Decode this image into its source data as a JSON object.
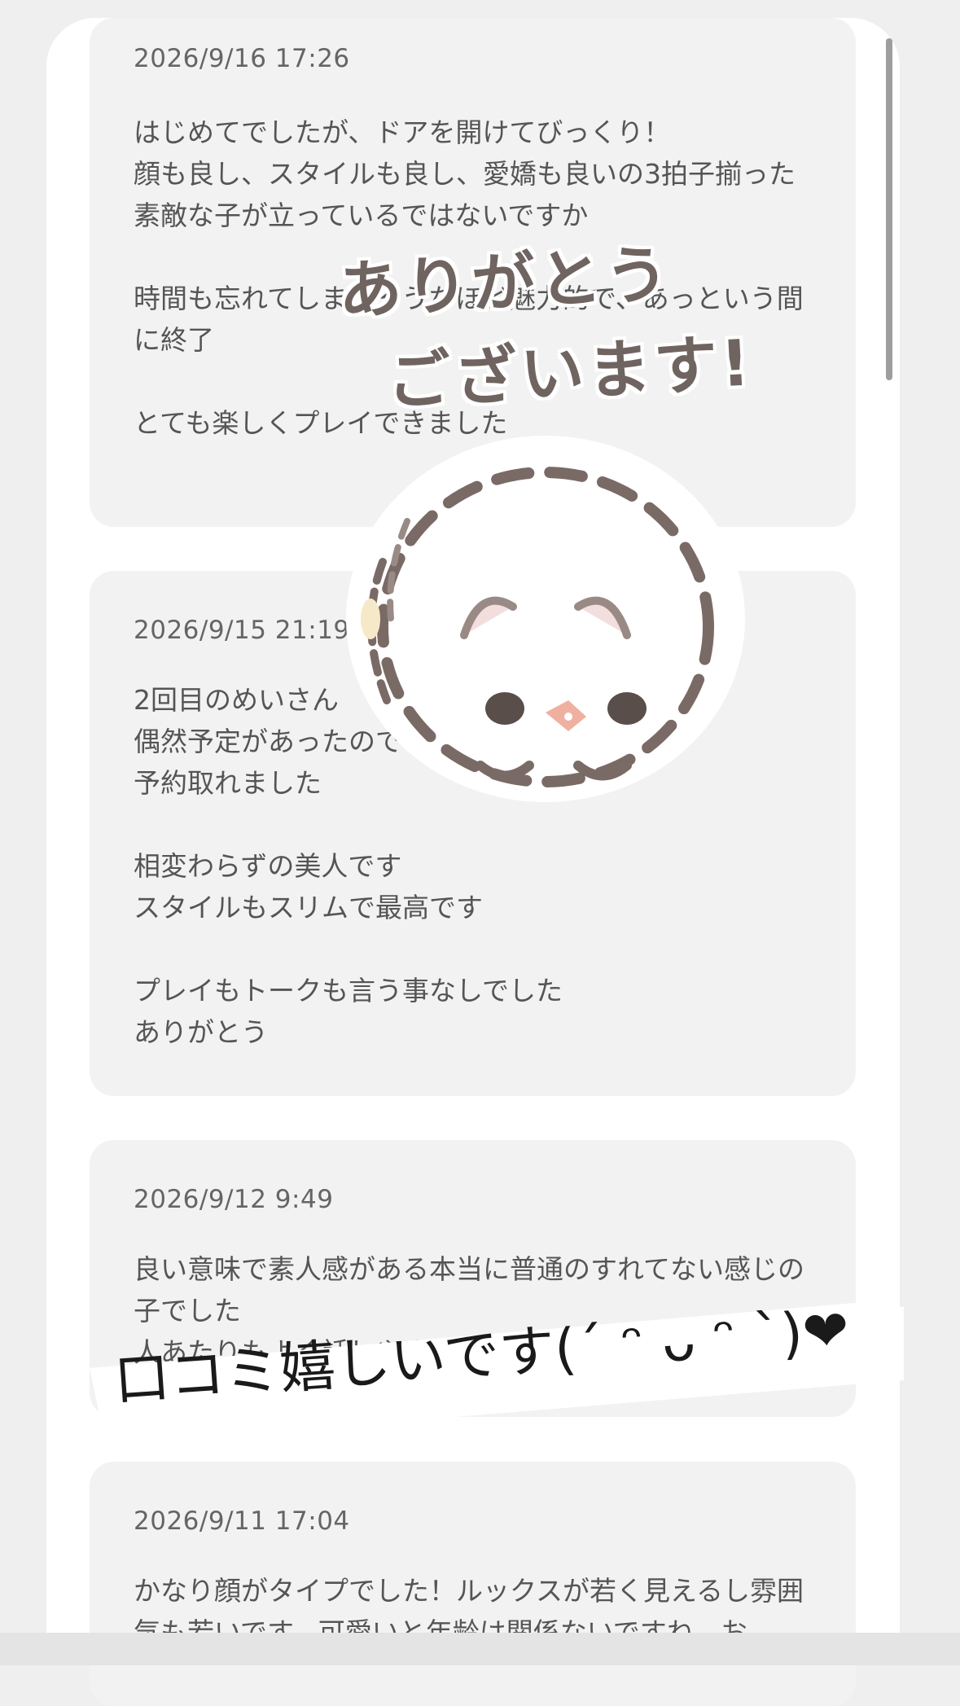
{
  "reviews": [
    {
      "date": "2026/9/16 17:26",
      "text": "はじめてでしたが、ドアを開けてびっくり！\n顔も良し、スタイルも良し、愛嬌も良いの3拍子揃った\n素敵な子が立っているではないですか\n\n時間も忘れてしまいそうなほど魅力的で、あっという間に終了\n\nとても楽しくプレイできました"
    },
    {
      "date": "2026/9/15 21:19",
      "text": "2回目のめいさん\n偶然予定があったので\n予約取れました\n\n相変わらずの美人です\nスタイルもスリムで最高です\n\nプレイもトークも言う事なしでした\nありがとう"
    },
    {
      "date": "2026/9/12 9:49",
      "text": "良い意味で素人感がある本当に普通のすれてない感じの子でした\n人あたりもよく話しやすい"
    },
    {
      "date": "2026/9/11 17:04",
      "text": "かなり顔がタイプでした！ルックスが若く見えるし雰囲気も若いです。可愛いと年齢は関係ないですね。お"
    }
  ],
  "stickers": {
    "thanks_line1": "ありがとう",
    "thanks_line2": "ございます!",
    "banner": "口コミ嬉しいです(ˊ ᵔ ᴗ ᵔ ˋ)❤"
  },
  "colors": {
    "card_bg": "#f2f2f2",
    "page_bg": "#efefef",
    "text": "#555555",
    "sticker_brown": "#6f6460"
  },
  "icons": [
    "hamster-sticker-icon",
    "heart-icon"
  ]
}
